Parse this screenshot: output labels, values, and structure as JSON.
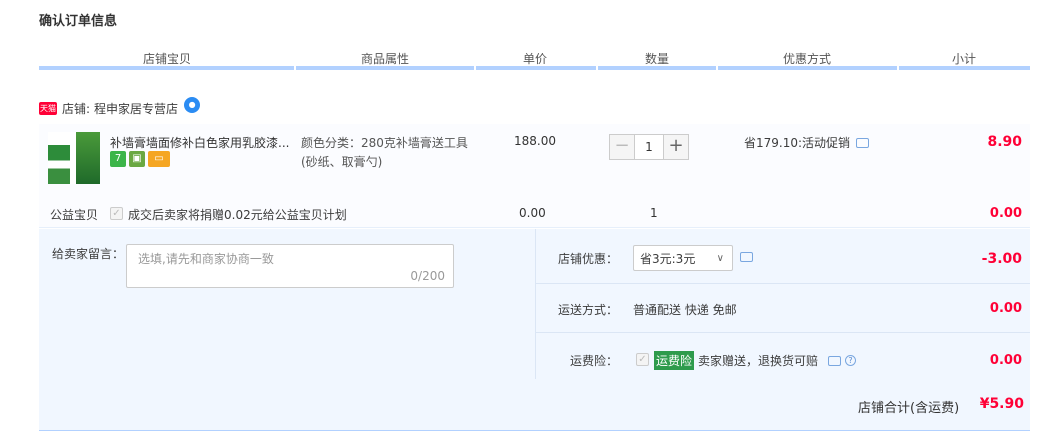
{
  "page_title": "确认订单信息",
  "columns": [
    "店铺宝贝",
    "商品属性",
    "单价",
    "数量",
    "优惠方式",
    "小计"
  ],
  "shop": {
    "badge": "天猫",
    "label": "店铺:",
    "name": "程申家居专营店"
  },
  "item": {
    "title": "补墙膏墙面修补白色家用乳胶漆...",
    "attribute_line1": "颜色分类：280克补墙膏送工具",
    "attribute_line2": "(砂纸、取膏勺)",
    "price": "188.00",
    "quantity": "1",
    "discount": "省179.10:活动促销",
    "subtotal": "8.90",
    "minus": "−",
    "plus": "+"
  },
  "charity": {
    "label": "公益宝贝",
    "text": "成交后卖家将捐赠0.02元给公益宝贝计划",
    "price": "0.00",
    "quantity": "1",
    "subtotal": "0.00"
  },
  "message": {
    "label": "给卖家留言：",
    "placeholder": "选填,请先和商家协商一致",
    "counter": "0/200"
  },
  "shop_discount": {
    "label": "店铺优惠：",
    "selected": "省3元:3元",
    "amount": "-3.00"
  },
  "shipping": {
    "label": "运送方式：",
    "value": "普通配送 快递 免邮",
    "amount": "0.00"
  },
  "insurance": {
    "label": "运费险：",
    "tag": "运费险",
    "text": "卖家赠送，退换货可赔",
    "amount": "0.00"
  },
  "total": {
    "label": "店铺合计(含运费)",
    "amount": "¥5.90"
  },
  "colors": {
    "accent_red": "#ff0036",
    "header_bar": "#b2d1ff",
    "panel_bg": "#f1f7ff",
    "insurance_green": "#2e9b4c"
  }
}
